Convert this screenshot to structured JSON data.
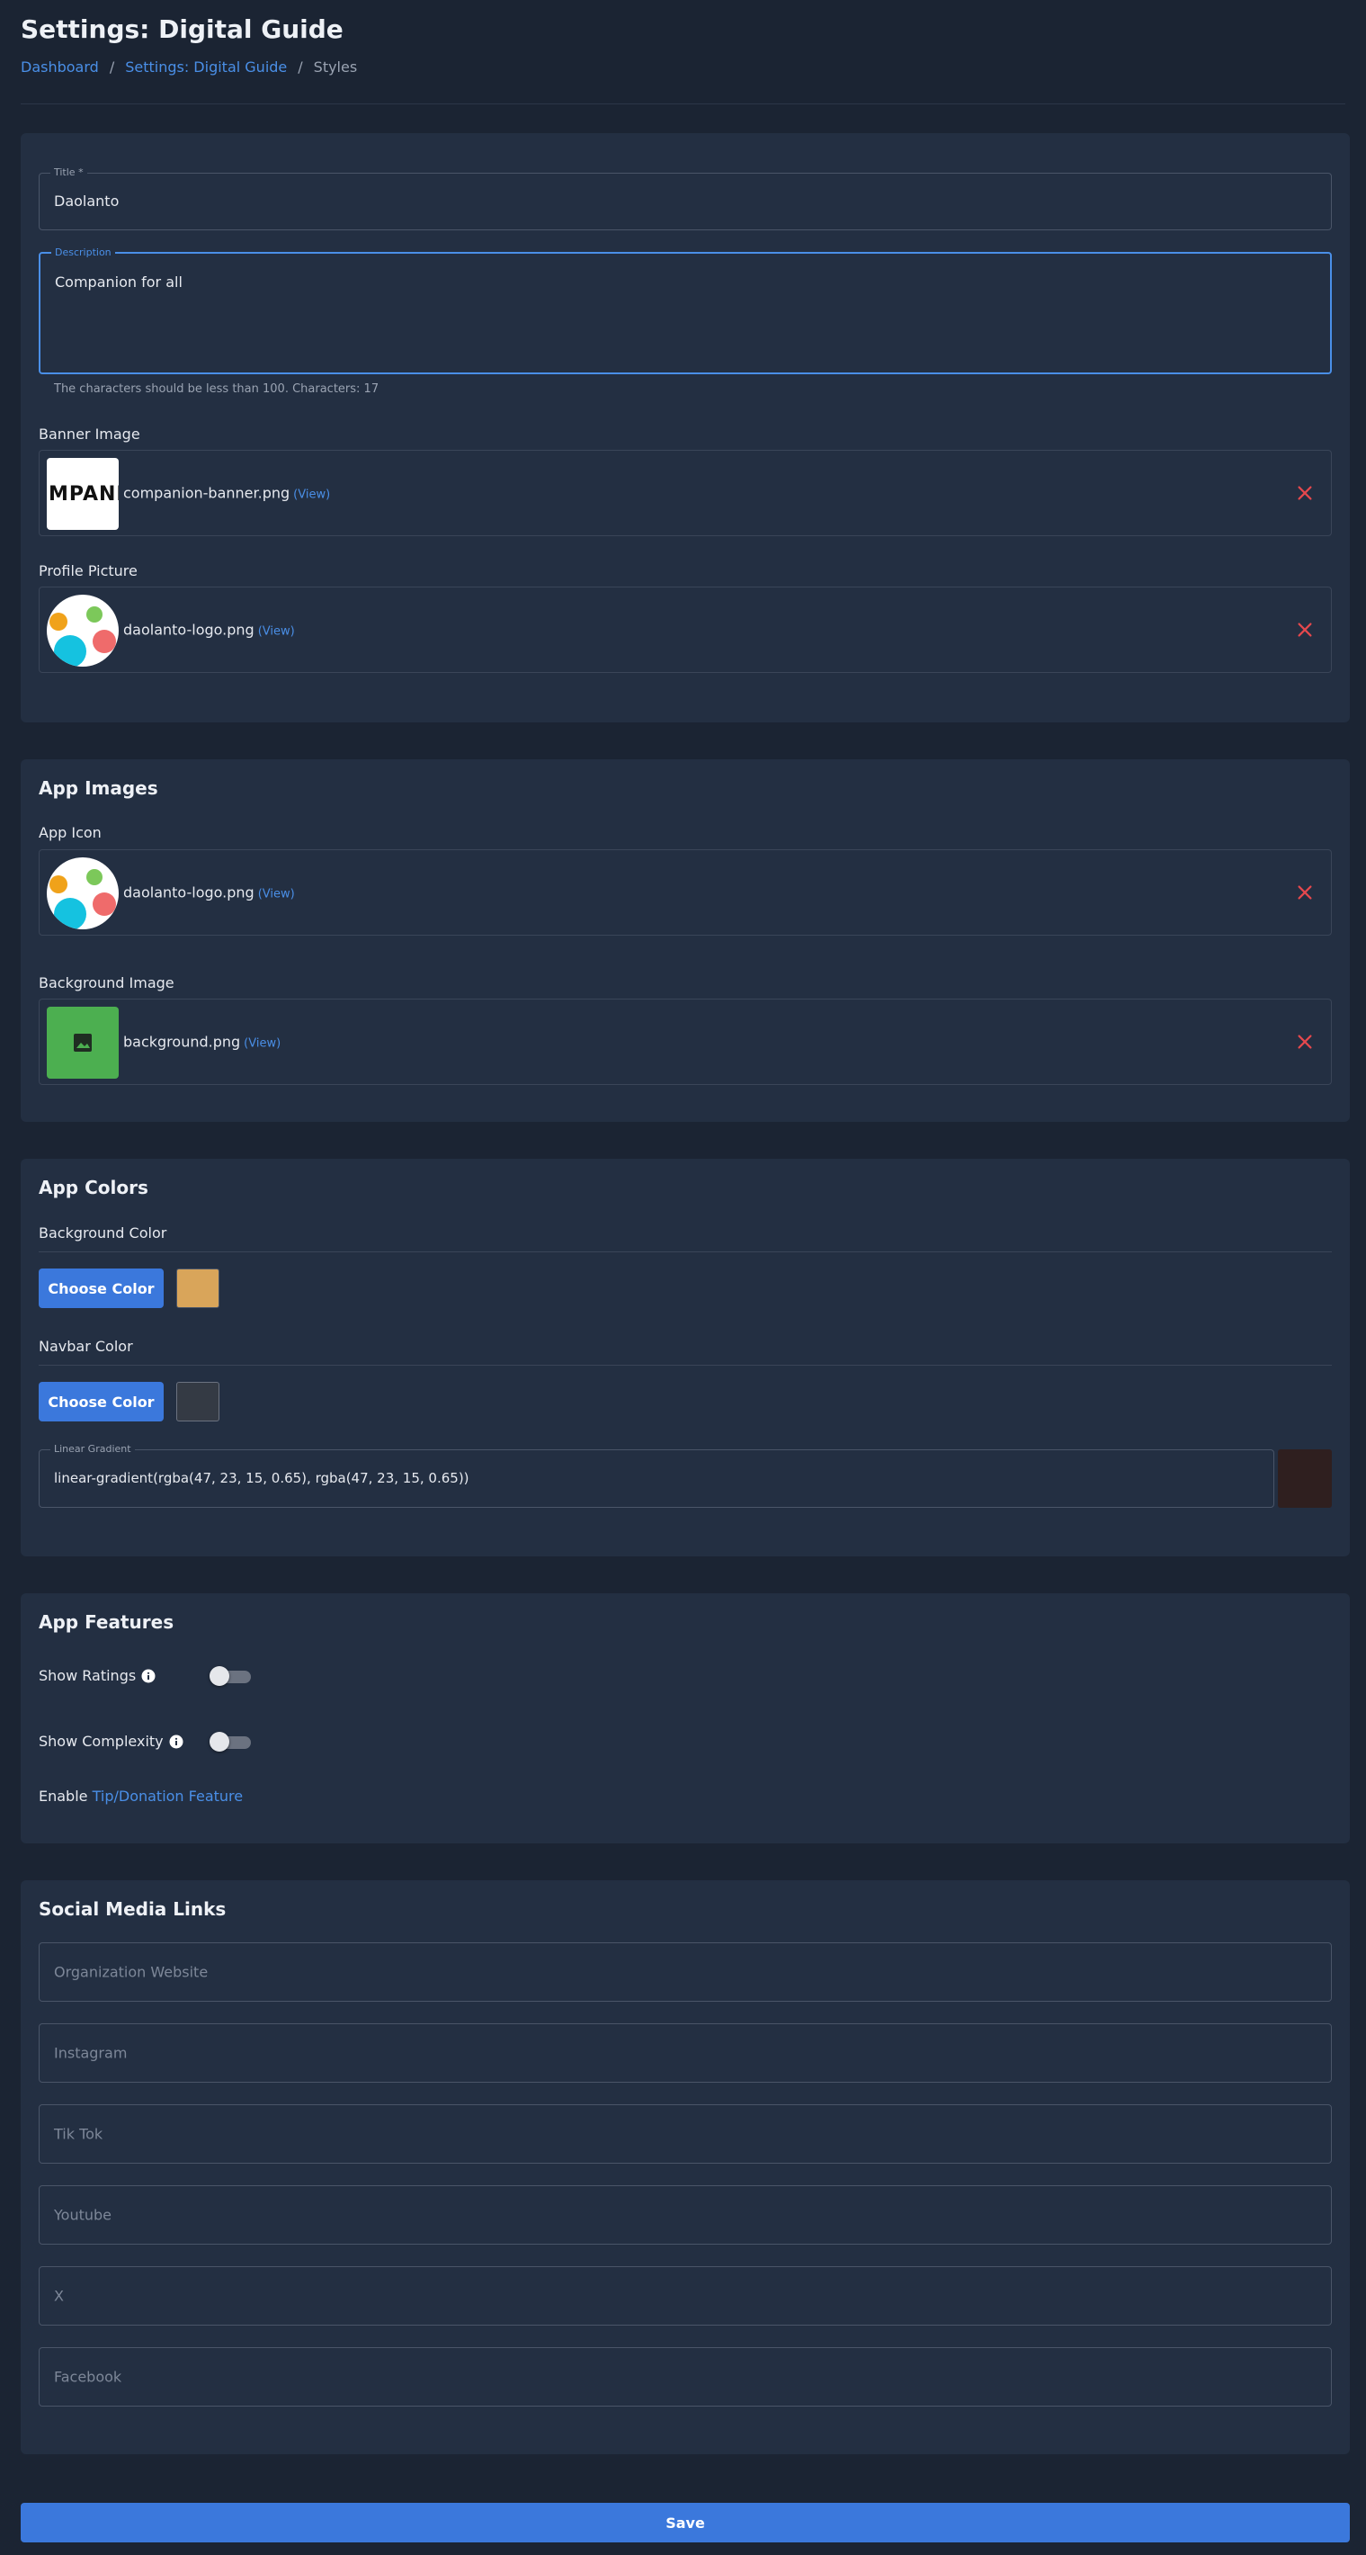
{
  "page": {
    "title": "Settings: Digital Guide"
  },
  "breadcrumb": {
    "items": [
      "Dashboard",
      "Settings: Digital Guide",
      "Styles"
    ],
    "separator": "/"
  },
  "general": {
    "title_field": {
      "label": "Title *",
      "value": "Daolanto"
    },
    "description_field": {
      "label": "Description",
      "value": "Companion for all"
    },
    "description_helper": "The characters should be less than 100. Characters: 17",
    "banner": {
      "label": "Banner Image",
      "file": "companion-banner.png",
      "view": "(View)",
      "thumb_text": "MPANI"
    },
    "profile": {
      "label": "Profile Picture",
      "file": "daolanto-logo.png",
      "view": "(View)"
    }
  },
  "app_images": {
    "title": "App Images",
    "icon": {
      "label": "App Icon",
      "file": "daolanto-logo.png",
      "view": "(View)"
    },
    "background": {
      "label": "Background Image",
      "file": "background.png",
      "view": "(View)"
    }
  },
  "app_colors": {
    "title": "App Colors",
    "background_color": {
      "label": "Background Color",
      "button": "Choose Color",
      "color": "#d9a55a"
    },
    "navbar_color": {
      "label": "Navbar Color",
      "button": "Choose Color",
      "color": "#343a44"
    },
    "gradient": {
      "label": "Linear Gradient",
      "value": "linear-gradient(rgba(47, 23, 15, 0.65), rgba(47, 23, 15, 0.65))",
      "color": "#2f1f1f"
    }
  },
  "app_features": {
    "title": "App Features",
    "show_ratings": {
      "label": "Show Ratings",
      "on": false
    },
    "show_complexity": {
      "label": "Show Complexity",
      "on": false
    },
    "enable_prefix": "Enable",
    "enable_link": "Tip/Donation Feature"
  },
  "social": {
    "title": "Social Media Links",
    "fields": [
      {
        "placeholder": "Organization Website"
      },
      {
        "placeholder": "Instagram"
      },
      {
        "placeholder": "Tik Tok"
      },
      {
        "placeholder": "Youtube"
      },
      {
        "placeholder": "X"
      },
      {
        "placeholder": "Facebook"
      }
    ]
  },
  "actions": {
    "save": "Save"
  },
  "colors": {
    "accent": "#3b78dc",
    "link": "#4a8fe7",
    "danger": "#e5484d",
    "card": "#232f42",
    "bg": "#1b2433"
  }
}
